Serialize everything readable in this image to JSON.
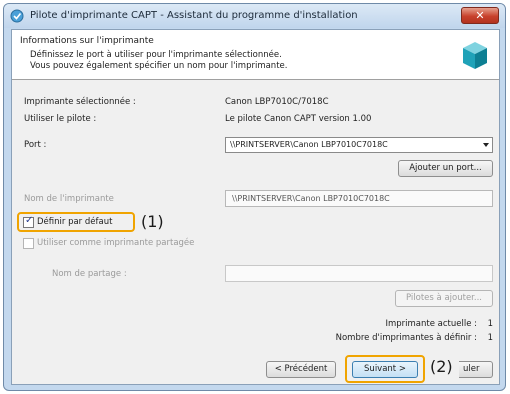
{
  "window": {
    "title": "Pilote d'imprimante CAPT - Assistant du programme d'installation",
    "close_label": "✕"
  },
  "header": {
    "title": "Informations sur l'imprimante",
    "line1": "Définissez le port à utiliser pour l'imprimante sélectionnée.",
    "line2": "Vous pouvez également spécifier un nom pour l'imprimante."
  },
  "fields": {
    "selected_printer_label": "Imprimante sélectionnée :",
    "selected_printer_value": "Canon LBP7010C/7018C",
    "driver_label": "Utiliser le pilote :",
    "driver_value": "Le pilote Canon CAPT version 1.00",
    "port_label": "Port :",
    "port_value": "\\\\PRINTSERVER\\Canon LBP7010C7018C",
    "add_port_label": "Ajouter un port...",
    "printer_name_label": "Nom de l'imprimante",
    "printer_name_value": "\\\\PRINTSERVER\\Canon LBP7010C7018C",
    "default_checkbox_label": "Définir par défaut",
    "shared_checkbox_label": "Utiliser comme imprimante partagée",
    "share_name_label": "Nom de partage :",
    "share_name_value": "",
    "drivers_to_add_label": "Pilotes à ajouter..."
  },
  "counts": {
    "current_label": "Imprimante actuelle :",
    "current_value": "1",
    "total_label": "Nombre d'imprimantes à définir :",
    "total_value": "1"
  },
  "footer": {
    "previous_label": "< Précédent",
    "next_label": "Suivant >",
    "cancel_partial_label": "uler"
  },
  "annotations": {
    "one": "(1)",
    "two": "(2)"
  },
  "colors": {
    "callout": "#f0a400",
    "close_button": "#c8412c"
  }
}
